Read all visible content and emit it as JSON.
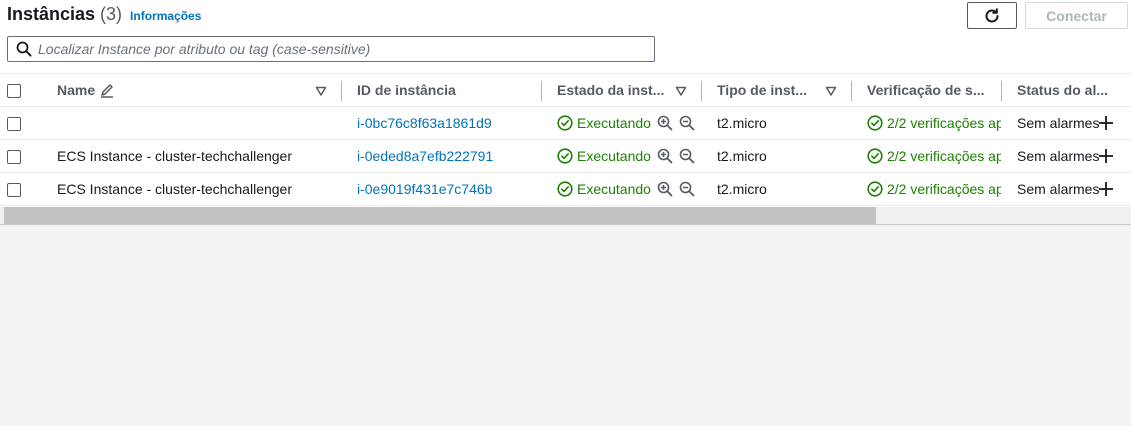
{
  "header": {
    "title": "Instâncias",
    "count": "(3)",
    "info_link": "Informações",
    "connect_label": "Conectar"
  },
  "search": {
    "placeholder": "Localizar Instance por atributo ou tag (case-sensitive)"
  },
  "columns": {
    "name": "Name",
    "instance_id": "ID de instância",
    "state": "Estado da inst...",
    "type": "Tipo de inst...",
    "check": "Verificação de s...",
    "alarm": "Status do al..."
  },
  "rows": [
    {
      "name": "",
      "instance_id": "i-0bc76c8f63a1861d9",
      "state": "Executando",
      "type": "t2.micro",
      "check": "2/2 verificações ap",
      "alarm": "Sem alarmes"
    },
    {
      "name": "ECS Instance - cluster-techchallenger",
      "instance_id": "i-0eded8a7efb222791",
      "state": "Executando",
      "type": "t2.micro",
      "check": "2/2 verificações ap",
      "alarm": "Sem alarmes"
    },
    {
      "name": "ECS Instance - cluster-techchallenger",
      "instance_id": "i-0e9019f431e7c746b",
      "state": "Executando",
      "type": "t2.micro",
      "check": "2/2 verificações ap",
      "alarm": "Sem alarmes"
    }
  ],
  "colors": {
    "link": "#0073bb",
    "success": "#1d8102",
    "header_text": "#545b64"
  },
  "icons": [
    "refresh-icon",
    "search-icon",
    "edit-pencil-icon",
    "sort-triangle-icon",
    "check-circle-icon",
    "zoom-in-icon",
    "zoom-out-icon",
    "plus-icon"
  ]
}
